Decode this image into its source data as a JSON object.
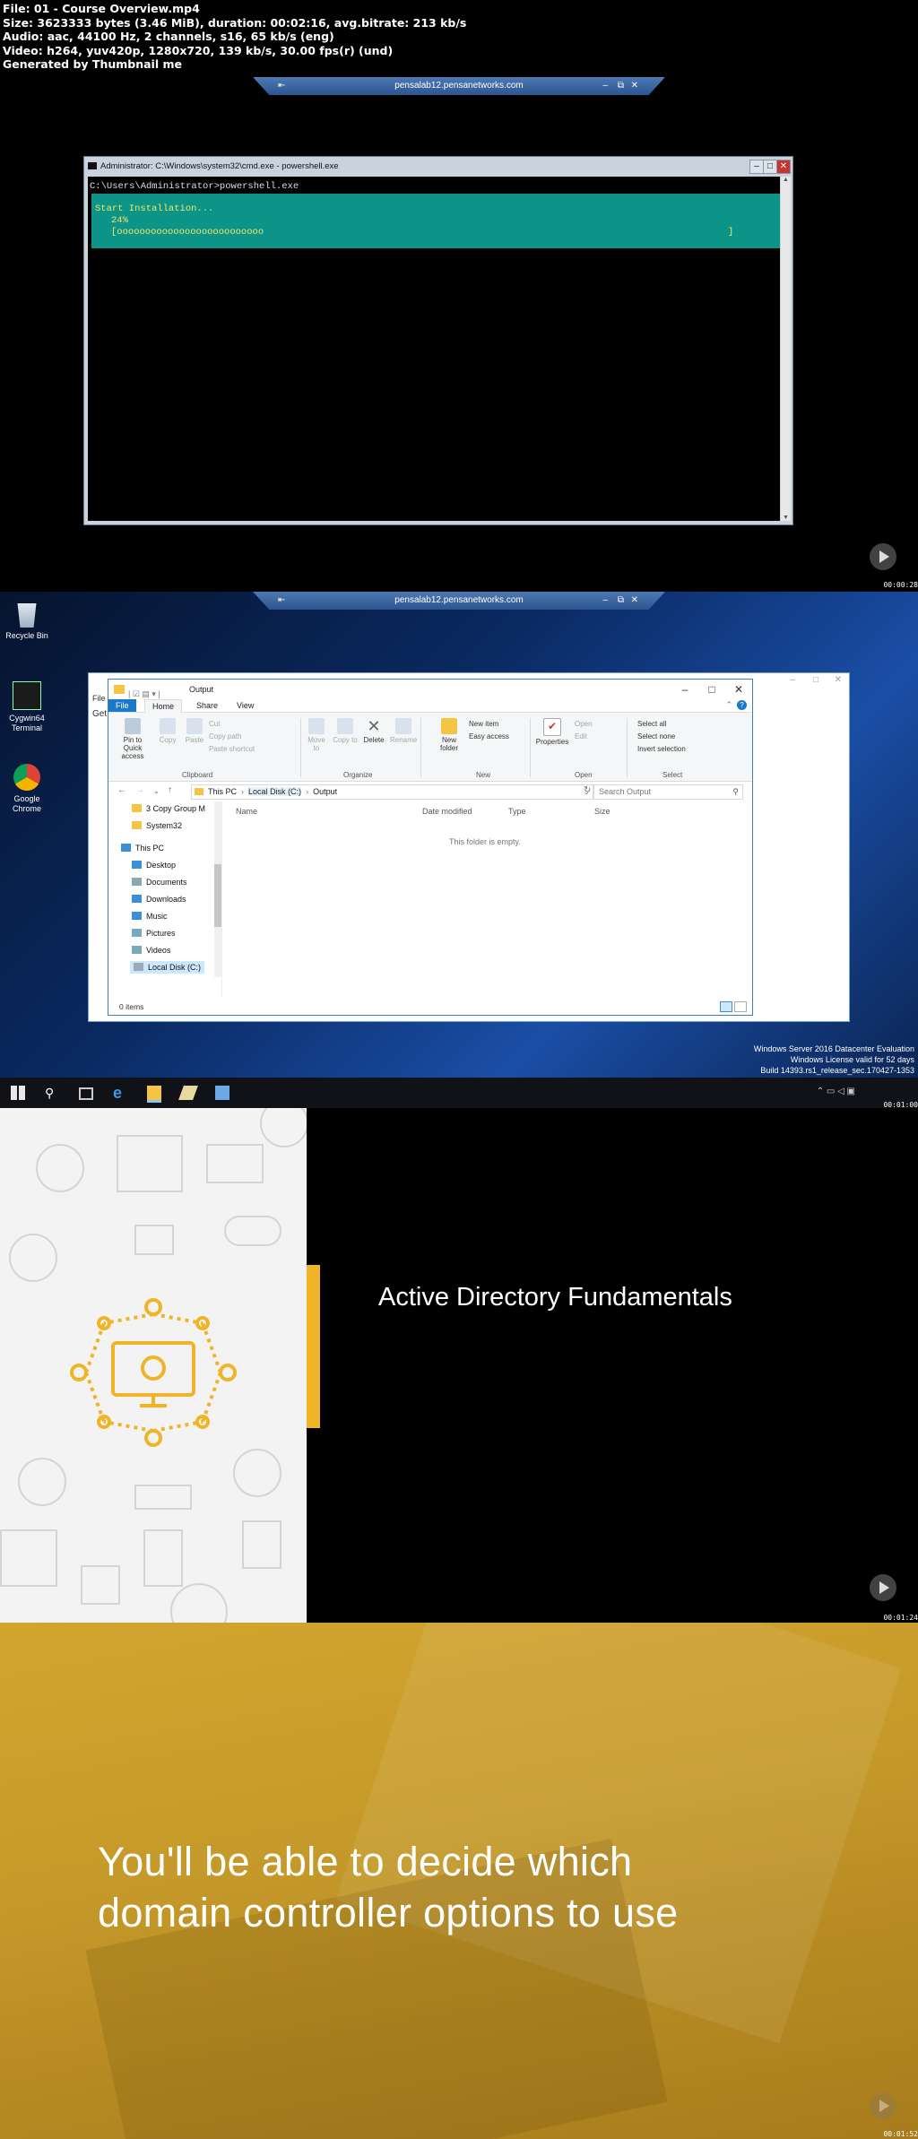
{
  "meta": {
    "file": "File: 01 - Course Overview.mp4",
    "size": "Size: 3623333 bytes (3.46 MiB), duration: 00:02:16, avg.bitrate: 213 kb/s",
    "audio": "Audio: aac, 44100 Hz, 2 channels, s16, 65 kb/s (eng)",
    "video": "Video: h264, yuv420p, 1280x720, 139 kb/s, 30.00 fps(r) (und)",
    "generated": "Generated by Thumbnail me"
  },
  "frame1": {
    "rdp_host": "pensalab12.pensanetworks.com",
    "cmd_title": "Administrator: C:\\Windows\\system32\\cmd.exe - powershell.exe",
    "prompt": "C:\\Users\\Administrator>powershell.exe",
    "progress_label": "Start Installation...",
    "progress_percent": "24%",
    "progress_bar": "[oooooooooooooooooooooooooo",
    "progress_end": "]",
    "progress_fraction": 0.24,
    "timestamp": "00:00:28"
  },
  "frame2": {
    "rdp_host": "pensalab12.pensanetworks.com",
    "desktop_icons": [
      "Recycle Bin",
      "Cygwin64 Terminal",
      "Google Chrome"
    ],
    "bg_window_menu": "File",
    "bg_window_text": "Get",
    "explorer": {
      "title": "Output",
      "tabs": [
        "File",
        "Home",
        "Share",
        "View"
      ],
      "ribbon": {
        "pin": "Pin to Quick access",
        "copy": "Copy",
        "paste": "Paste",
        "cut": "Cut",
        "copy_path": "Copy path",
        "paste_shortcut": "Paste shortcut",
        "clipboard": "Clipboard",
        "move_to": "Move to",
        "copy_to": "Copy to",
        "delete": "Delete",
        "rename": "Rename",
        "organize": "Organize",
        "new_item": "New item",
        "easy_access": "Easy access",
        "new_folder": "New folder",
        "new_group": "New",
        "properties": "Properties",
        "open": "Open",
        "edit": "Edit",
        "open_group": "Open",
        "select_all": "Select all",
        "select_none": "Select none",
        "invert_selection": "Invert selection",
        "select_group": "Select"
      },
      "breadcrumb": [
        "This PC",
        "Local Disk (C:)",
        "Output"
      ],
      "search_placeholder": "Search Output",
      "tree": [
        "3 Copy Group M",
        "System32",
        "This PC",
        "Desktop",
        "Documents",
        "Downloads",
        "Music",
        "Pictures",
        "Videos",
        "Local Disk (C:)"
      ],
      "columns": [
        "Name",
        "Date modified",
        "Type",
        "Size"
      ],
      "empty": "This folder is empty.",
      "status": "0 items"
    },
    "watermark": [
      "Windows Server 2016 Datacenter Evaluation",
      "Windows License valid for 52 days",
      "Build 14393.rs1_release_sec.170427-1353"
    ],
    "timestamp": "00:01:00"
  },
  "frame3": {
    "title": "Active Directory Fundamentals",
    "accent": "#f0b429",
    "timestamp": "00:01:24"
  },
  "frame4": {
    "line1": "You'll be able to decide which",
    "line2": "domain controller options to use",
    "timestamp": "00:01:52"
  }
}
